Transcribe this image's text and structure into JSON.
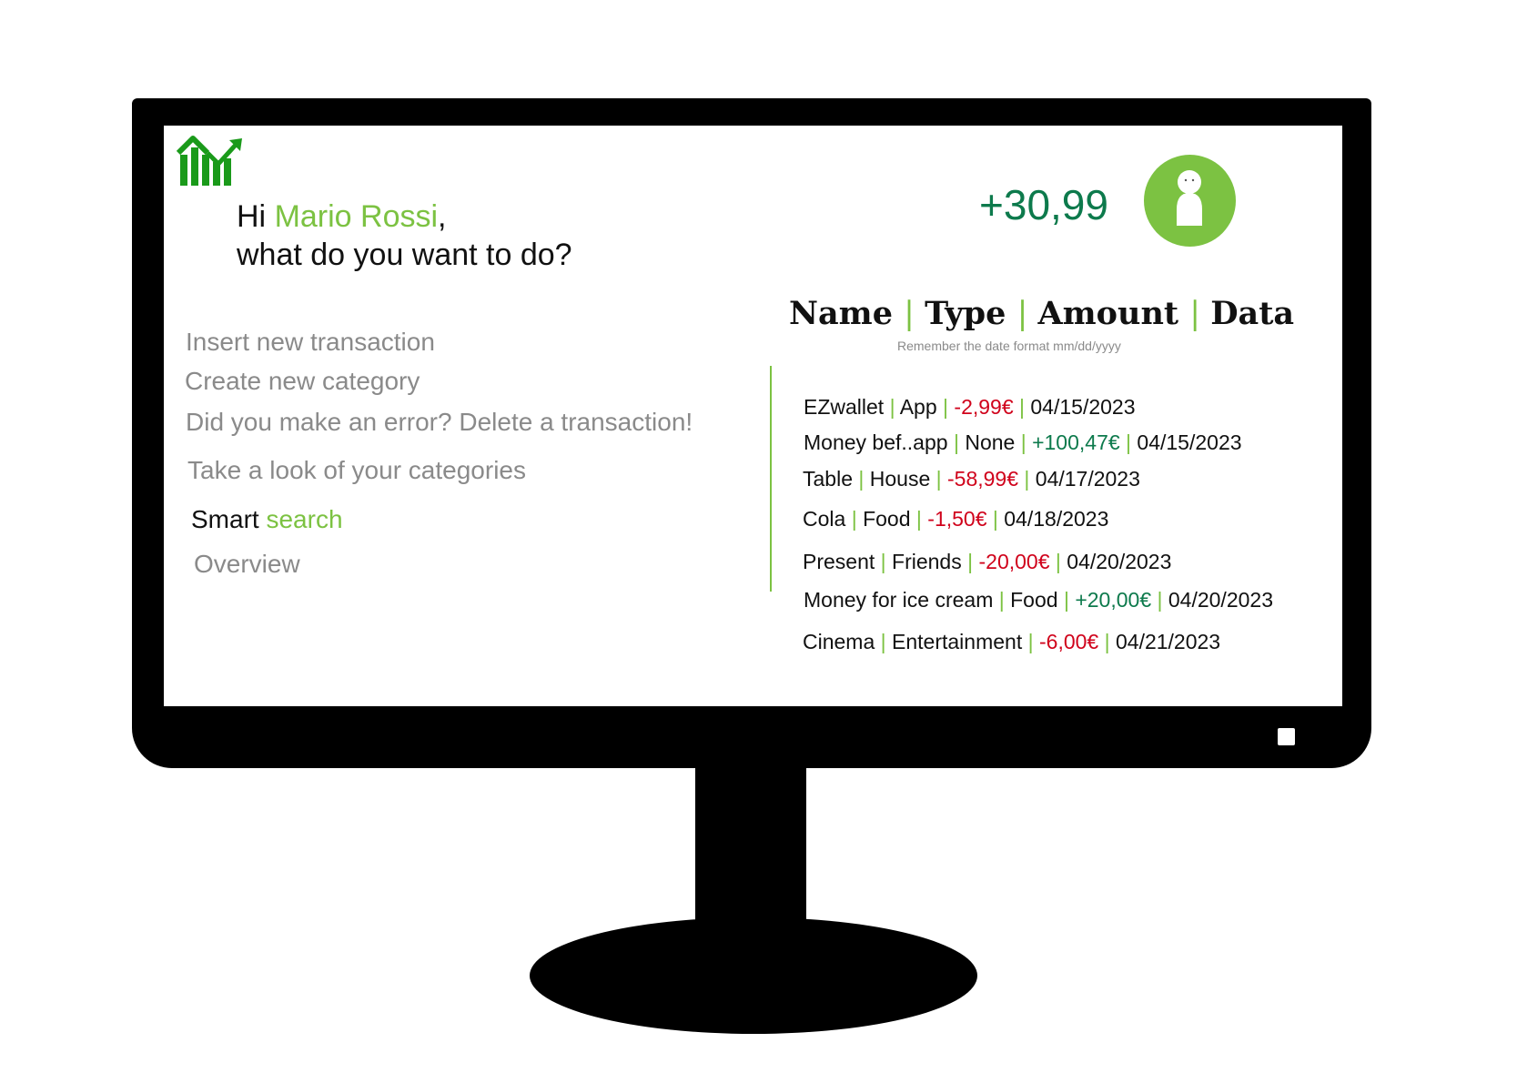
{
  "header": {
    "greeting_prefix": "Hi ",
    "user_name": "Mario Rossi",
    "greeting_suffix": ",",
    "question": "what do you want to do?",
    "balance": "+30,99",
    "logo_icon": "bar-chart-trend-icon",
    "avatar_icon": "user-avatar-icon"
  },
  "menu": {
    "insert_transaction": "Insert new transaction",
    "create_category": "Create new category",
    "delete_transaction": "Did you make an error? Delete a transaction!",
    "view_categories": "Take a look of your categories",
    "smart_search_prefix": "Smart ",
    "smart_search_accent": "search",
    "overview": "Overview"
  },
  "table": {
    "columns": [
      "Name",
      "Type",
      "Amount",
      "Data"
    ],
    "date_hint": "Remember the date format mm/dd/yyyy",
    "rows": [
      {
        "name": "EZwallet",
        "type": "App",
        "amount": "-2,99€",
        "date": "04/15/2023"
      },
      {
        "name": "Money bef..app",
        "type": "None",
        "amount": "+100,47€",
        "date": "04/15/2023"
      },
      {
        "name": "Table",
        "type": "House",
        "amount": "-58,99€",
        "date": "04/17/2023"
      },
      {
        "name": "Cola",
        "type": "Food",
        "amount": "-1,50€",
        "date": "04/18/2023"
      },
      {
        "name": "Present",
        "type": "Friends",
        "amount": "-20,00€",
        "date": "04/20/2023"
      },
      {
        "name": "Money for ice cream",
        "type": "Food",
        "amount": "+20,00€",
        "date": "04/20/2023"
      },
      {
        "name": "Cinema",
        "type": "Entertainment",
        "amount": "-6,00€",
        "date": "04/21/2023"
      }
    ]
  },
  "colors": {
    "accent_green": "#7cc242",
    "positive_green": "#0d7a4c",
    "negative_red": "#d0021b",
    "muted_gray": "#8a8a8a"
  }
}
